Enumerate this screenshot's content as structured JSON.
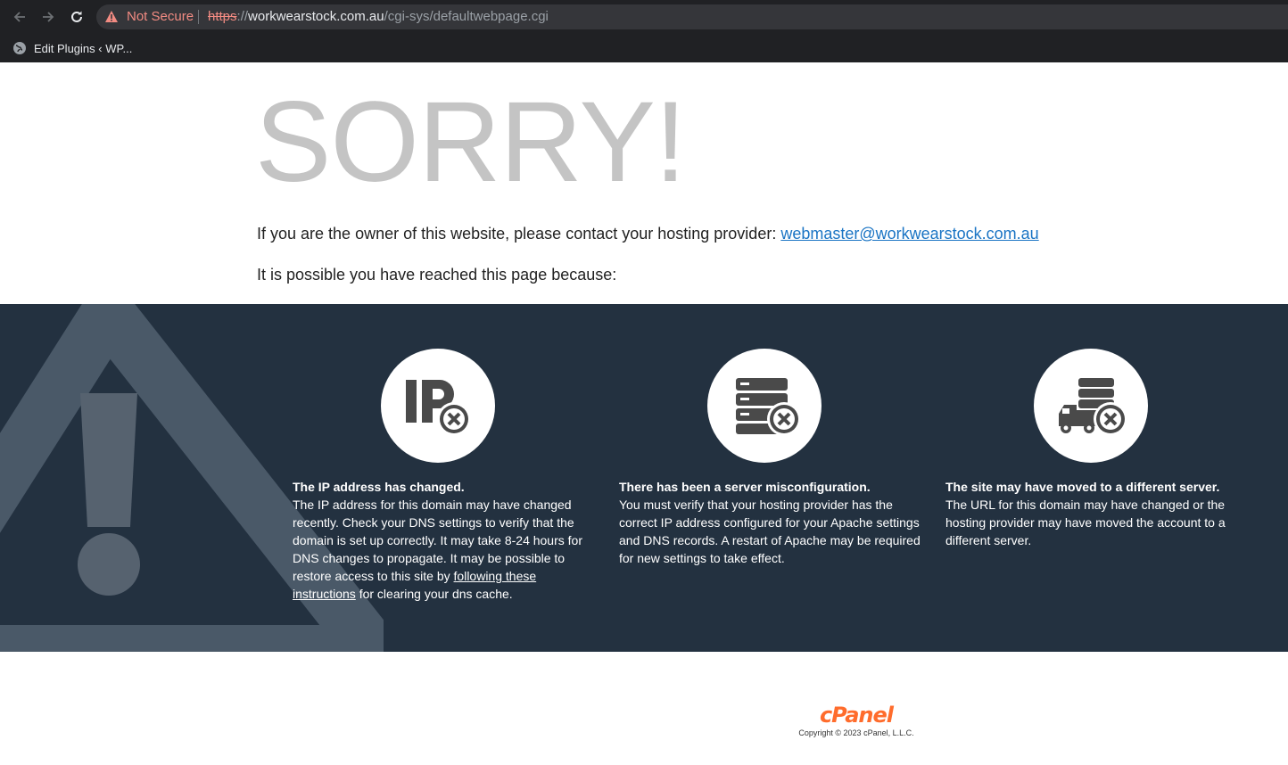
{
  "browser": {
    "security_label": "Not Secure",
    "url_scheme": "https",
    "url_sep": "://",
    "url_host": "workwearstock.com.au",
    "url_path": "/cgi-sys/defaultwebpage.cgi",
    "bookmark_label": "Edit Plugins ‹ WP..."
  },
  "page": {
    "headline": "SORRY!",
    "contact_text": "If you are the owner of this website, please contact your hosting provider: ",
    "contact_email": "webmaster@workwearstock.com.au",
    "reason_intro": "It is possible you have reached this page because:"
  },
  "reasons": [
    {
      "icon": "ip-address-error-icon",
      "title": "The IP address has changed.",
      "body_pre": "The IP address for this domain may have changed recently. Check your DNS settings to verify that the domain is set up correctly. It may take 8-24 hours for DNS changes to propagate. It may be possible to restore access to this site by ",
      "link": "following these instructions",
      "body_post": " for clearing your dns cache."
    },
    {
      "icon": "server-error-icon",
      "title": "There has been a server misconfiguration.",
      "body": "You must verify that your hosting provider has the correct IP address configured for your Apache settings and DNS records. A restart of Apache may be required for new settings to take effect."
    },
    {
      "icon": "server-moved-error-icon",
      "title": "The site may have moved to a different server.",
      "body": "The URL for this domain may have changed or the hosting provider may have moved the account to a different server."
    }
  ],
  "footer": {
    "logo": "cPanel",
    "copyright": "Copyright © 2023 cPanel, L.L.C."
  },
  "colors": {
    "band": "#233140",
    "headline": "#c4c4c4",
    "link": "#1a74c4",
    "brand": "#ff6c2c"
  }
}
